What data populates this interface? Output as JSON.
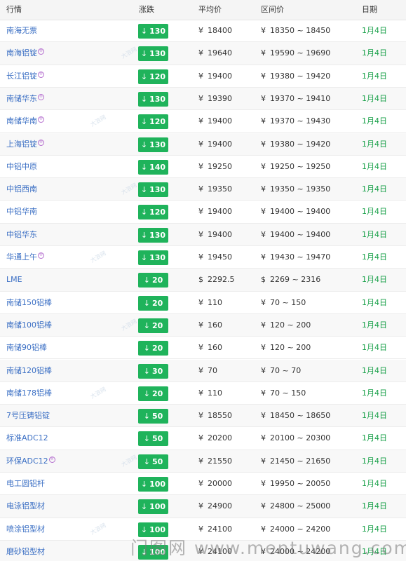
{
  "columns": {
    "market": "行情",
    "change": "涨跌",
    "avg": "平均价",
    "range": "区间价",
    "date": "日期"
  },
  "colors": {
    "badge_green": "#1fb35b",
    "link_blue": "#3b6fc4",
    "date_green": "#1aa14a"
  },
  "rows": [
    {
      "name": "南海无票",
      "mark": false,
      "dir": "down",
      "change": "130",
      "avg_currency": "¥",
      "avg": "18400",
      "range_currency": "¥",
      "range": "18350 ~ 18450",
      "date": "1月4日"
    },
    {
      "name": "南海铝锭",
      "mark": true,
      "dir": "down",
      "change": "130",
      "avg_currency": "¥",
      "avg": "19640",
      "range_currency": "¥",
      "range": "19590 ~ 19690",
      "date": "1月4日"
    },
    {
      "name": "长江铝锭",
      "mark": true,
      "dir": "down",
      "change": "120",
      "avg_currency": "¥",
      "avg": "19400",
      "range_currency": "¥",
      "range": "19380 ~ 19420",
      "date": "1月4日"
    },
    {
      "name": "南储华东",
      "mark": true,
      "dir": "down",
      "change": "130",
      "avg_currency": "¥",
      "avg": "19390",
      "range_currency": "¥",
      "range": "19370 ~ 19410",
      "date": "1月4日"
    },
    {
      "name": "南储华南",
      "mark": true,
      "dir": "down",
      "change": "120",
      "avg_currency": "¥",
      "avg": "19400",
      "range_currency": "¥",
      "range": "19370 ~ 19430",
      "date": "1月4日"
    },
    {
      "name": "上海铝锭",
      "mark": true,
      "dir": "down",
      "change": "130",
      "avg_currency": "¥",
      "avg": "19400",
      "range_currency": "¥",
      "range": "19380 ~ 19420",
      "date": "1月4日"
    },
    {
      "name": "中铝中原",
      "mark": false,
      "dir": "down",
      "change": "140",
      "avg_currency": "¥",
      "avg": "19250",
      "range_currency": "¥",
      "range": "19250 ~ 19250",
      "date": "1月4日"
    },
    {
      "name": "中铝西南",
      "mark": false,
      "dir": "down",
      "change": "130",
      "avg_currency": "¥",
      "avg": "19350",
      "range_currency": "¥",
      "range": "19350 ~ 19350",
      "date": "1月4日"
    },
    {
      "name": "中铝华南",
      "mark": false,
      "dir": "down",
      "change": "120",
      "avg_currency": "¥",
      "avg": "19400",
      "range_currency": "¥",
      "range": "19400 ~ 19400",
      "date": "1月4日"
    },
    {
      "name": "中铝华东",
      "mark": false,
      "dir": "down",
      "change": "130",
      "avg_currency": "¥",
      "avg": "19400",
      "range_currency": "¥",
      "range": "19400 ~ 19400",
      "date": "1月4日"
    },
    {
      "name": "华通上午",
      "mark": true,
      "dir": "down",
      "change": "130",
      "avg_currency": "¥",
      "avg": "19450",
      "range_currency": "¥",
      "range": "19430 ~ 19470",
      "date": "1月4日"
    },
    {
      "name": "LME",
      "mark": false,
      "dir": "down",
      "change": "20",
      "avg_currency": "$",
      "avg": "2292.5",
      "range_currency": "$",
      "range": "2269 ~ 2316",
      "date": "1月4日"
    },
    {
      "name": "南储150铝棒",
      "mark": false,
      "dir": "down",
      "change": "20",
      "avg_currency": "¥",
      "avg": "110",
      "range_currency": "¥",
      "range": "70 ~ 150",
      "date": "1月4日"
    },
    {
      "name": "南储100铝棒",
      "mark": false,
      "dir": "down",
      "change": "20",
      "avg_currency": "¥",
      "avg": "160",
      "range_currency": "¥",
      "range": "120 ~ 200",
      "date": "1月4日"
    },
    {
      "name": "南储90铝棒",
      "mark": false,
      "dir": "down",
      "change": "20",
      "avg_currency": "¥",
      "avg": "160",
      "range_currency": "¥",
      "range": "120 ~ 200",
      "date": "1月4日"
    },
    {
      "name": "南储120铝棒",
      "mark": false,
      "dir": "down",
      "change": "30",
      "avg_currency": "¥",
      "avg": "70",
      "range_currency": "¥",
      "range": "70 ~ 70",
      "date": "1月4日"
    },
    {
      "name": "南储178铝棒",
      "mark": false,
      "dir": "down",
      "change": "20",
      "avg_currency": "¥",
      "avg": "110",
      "range_currency": "¥",
      "range": "70 ~ 150",
      "date": "1月4日"
    },
    {
      "name": "7号压铸铝锭",
      "mark": false,
      "dir": "down",
      "change": "50",
      "avg_currency": "¥",
      "avg": "18550",
      "range_currency": "¥",
      "range": "18450 ~ 18650",
      "date": "1月4日"
    },
    {
      "name": "标准ADC12",
      "mark": false,
      "dir": "down",
      "change": "50",
      "avg_currency": "¥",
      "avg": "20200",
      "range_currency": "¥",
      "range": "20100 ~ 20300",
      "date": "1月4日"
    },
    {
      "name": "环保ADC12",
      "mark": true,
      "dir": "down",
      "change": "50",
      "avg_currency": "¥",
      "avg": "21550",
      "range_currency": "¥",
      "range": "21450 ~ 21650",
      "date": "1月4日"
    },
    {
      "name": "电工圆铝杆",
      "mark": false,
      "dir": "down",
      "change": "100",
      "avg_currency": "¥",
      "avg": "20000",
      "range_currency": "¥",
      "range": "19950 ~ 20050",
      "date": "1月4日"
    },
    {
      "name": "电泳铝型材",
      "mark": false,
      "dir": "down",
      "change": "100",
      "avg_currency": "¥",
      "avg": "24900",
      "range_currency": "¥",
      "range": "24800 ~ 25000",
      "date": "1月4日"
    },
    {
      "name": "喷涂铝型材",
      "mark": false,
      "dir": "down",
      "change": "100",
      "avg_currency": "¥",
      "avg": "24100",
      "range_currency": "¥",
      "range": "24000 ~ 24200",
      "date": "1月4日"
    },
    {
      "name": "磨砂铝型材",
      "mark": false,
      "dir": "down",
      "change": "100",
      "avg_currency": "¥",
      "avg": "24100",
      "range_currency": "¥",
      "range": "24000 ~ 24200",
      "date": "1月4日"
    }
  ],
  "watermark": "门图网 www.mentuwang.com",
  "row_watermark": "大浪网",
  "mark_glyph": "®",
  "arrow_glyph": "↓"
}
